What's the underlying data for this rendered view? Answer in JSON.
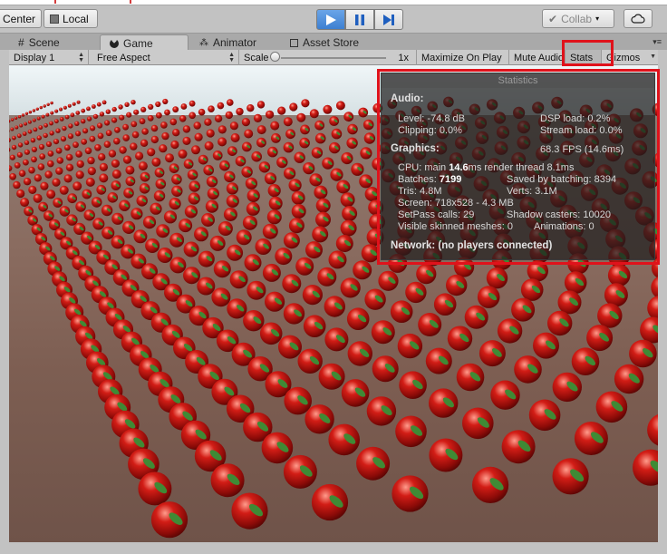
{
  "toolbar": {
    "center_label": "Center",
    "local_label": "Local",
    "collab_label": "Collab",
    "colors": {
      "play_active": "#3d7fd1",
      "highlight": "#e0121b"
    }
  },
  "tabs": [
    {
      "label": "Scene",
      "icon": "hash-icon"
    },
    {
      "label": "Game",
      "icon": "pacman-icon"
    },
    {
      "label": "Animator",
      "icon": "animator-icon"
    },
    {
      "label": "Asset Store",
      "icon": "store-icon"
    }
  ],
  "gamebar": {
    "display": "Display 1",
    "aspect": "Free Aspect",
    "scale_label": "Scale",
    "scale_value": "1x",
    "maximize": "Maximize On Play",
    "mute": "Mute Audio",
    "stats": "Stats",
    "gizmos": "Gizmos"
  },
  "stats": {
    "title": "Statistics",
    "audio_header": "Audio:",
    "level": "Level: -74.8 dB",
    "dsp": "DSP load: 0.2%",
    "clipping": "Clipping: 0.0%",
    "stream": "Stream load: 0.0%",
    "graphics_header": "Graphics:",
    "fps": "68.3 FPS (14.6ms)",
    "cpu_prefix": "CPU: main ",
    "cpu_main": "14.6",
    "cpu_suffix": "ms  render thread 8.1ms",
    "batches_prefix": "Batches: ",
    "batches": "7199",
    "saved": "Saved by batching: 8394",
    "tris": "Tris: 4.8M",
    "verts": "Verts: 3.1M",
    "screen": "Screen: 718x528 - 4.3 MB",
    "setpass": "SetPass calls: 29",
    "shadow": "Shadow casters: 10020",
    "skinned": "Visible skinned meshes: 0",
    "animations": "Animations: 0",
    "network": "Network: (no players connected)"
  }
}
